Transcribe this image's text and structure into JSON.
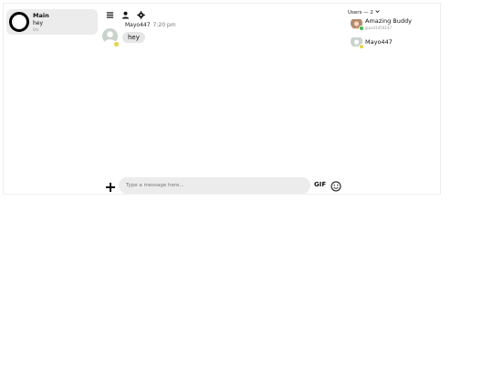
{
  "conversations": [
    {
      "title": "Main",
      "preview": "hey",
      "time": "0m"
    }
  ],
  "toolbar": {
    "icons": [
      "menu-icon",
      "user-icon",
      "settings-icon"
    ]
  },
  "messages": [
    {
      "author": "Mayo447",
      "time": "7:20 pm",
      "text": "hey",
      "status_color": "#e2d548"
    }
  ],
  "users": {
    "header": "Users — 2",
    "list": [
      {
        "name": "Amazing Buddy",
        "subtitle": "guest1459147",
        "status_color": "#3fb950"
      },
      {
        "name": "Mayo447",
        "subtitle": "",
        "status_color": "#e2d548"
      }
    ]
  },
  "composer": {
    "placeholder": "Type a message here...",
    "gif_label": "GIF"
  }
}
